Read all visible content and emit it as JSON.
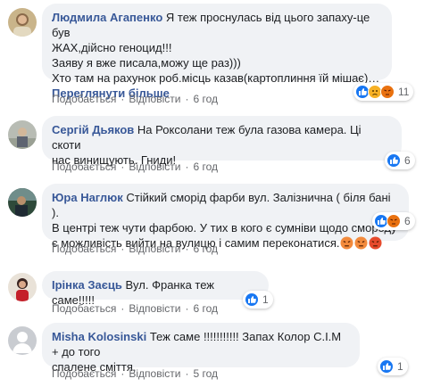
{
  "comments": [
    {
      "author": "Людмила Агапенко",
      "text_lines": [
        "Я теж проснулась від цього запаху-це був",
        "ЖАХ,дійсно геноцид!!!",
        "Заяву я вже писала,можу ще раз)))",
        "Хто там на рахунок роб.місць казав(картоплиння їй мішає)…"
      ],
      "see_more": "Переглянути більше",
      "actions": {
        "like": "Подобається",
        "reply": "Відповісти",
        "time": "6 год"
      },
      "reactions": {
        "icons": [
          "like-icon",
          "sad-icon",
          "angry-icon"
        ],
        "count": "11"
      }
    },
    {
      "author": "Сергій Дьяков",
      "text_lines": [
        "На Роксолани теж була газова камера. Ці скоти",
        "нас винищують. Гниди!"
      ],
      "actions": {
        "like": "Подобається",
        "reply": "Відповісти",
        "time": "6 год"
      },
      "reactions": {
        "icons": [
          "like-icon"
        ],
        "count": "6"
      }
    },
    {
      "author": "Юра Наглюк",
      "text_lines": [
        "Стійкий сморід фарби вул. Залізнична ( біля бані ).",
        "В центрі теж чути фарбою. У тих в кого є сумніви щодо смороду",
        "є можливість вийти на вулицю і самим переконатися."
      ],
      "emojis": [
        "angry-emoji",
        "angry-emoji",
        "angry-emoji"
      ],
      "actions": {
        "like": "Подобається",
        "reply": "Відповісти",
        "time": "6 год"
      },
      "reactions": {
        "icons": [
          "like-icon",
          "angry-icon"
        ],
        "count": "6"
      }
    },
    {
      "author": "Ірінка Заєць",
      "text_lines": [
        "Вул. Франка теж саме!!!!!"
      ],
      "actions": {
        "like": "Подобається",
        "reply": "Відповісти",
        "time": "6 год"
      },
      "reactions": {
        "icons": [
          "like-icon"
        ],
        "count": "1"
      }
    },
    {
      "author": "Misha Kolosinski",
      "text_lines": [
        "Теж саме !!!!!!!!!!! Запах Колор С.І.М + до того",
        "спалене сміття."
      ],
      "actions": {
        "like": "Подобається",
        "reply": "Відповісти",
        "time": "5 год"
      },
      "reactions": {
        "icons": [
          "like-icon"
        ],
        "count": "1"
      }
    }
  ],
  "colors": {
    "like": "#1877f2",
    "sad": "#f7b125",
    "angry": "#e9710f",
    "name": "#385898",
    "bubble": "#f0f2f5"
  }
}
